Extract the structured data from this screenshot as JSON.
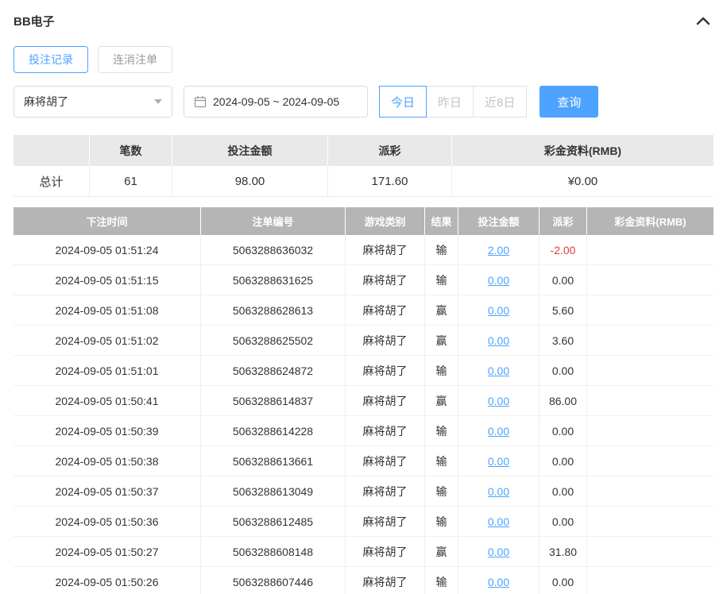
{
  "page": {
    "title": "BB电子"
  },
  "tabs": [
    {
      "label": "投注记录",
      "active": true
    },
    {
      "label": "连消注单",
      "active": false
    }
  ],
  "filters": {
    "game_select_value": "麻将胡了",
    "date_range_value": "2024-09-05 ~ 2024-09-05",
    "quick_buttons": [
      {
        "label": "今日",
        "active": true
      },
      {
        "label": "昨日",
        "active": false
      },
      {
        "label": "近8日",
        "active": false
      }
    ],
    "search_label": "查询"
  },
  "summary": {
    "headers": [
      "",
      "笔数",
      "投注金额",
      "派彩",
      "彩金资料(RMB)"
    ],
    "row": {
      "label": "总计",
      "count": "61",
      "bet_amount": "98.00",
      "payout": "171.60",
      "bonus": "¥0.00"
    }
  },
  "table": {
    "headers": [
      "下注时间",
      "注单编号",
      "游戏类别",
      "结果",
      "投注金额",
      "派彩",
      "彩金资料(RMB)"
    ],
    "rows": [
      {
        "time": "2024-09-05 01:51:24",
        "order": "5063288636032",
        "game": "麻将胡了",
        "result": "输",
        "bet": "2.00",
        "payout": "-2.00",
        "bonus": ""
      },
      {
        "time": "2024-09-05 01:51:15",
        "order": "5063288631625",
        "game": "麻将胡了",
        "result": "输",
        "bet": "0.00",
        "payout": "0.00",
        "bonus": ""
      },
      {
        "time": "2024-09-05 01:51:08",
        "order": "5063288628613",
        "game": "麻将胡了",
        "result": "赢",
        "bet": "0.00",
        "payout": "5.60",
        "bonus": ""
      },
      {
        "time": "2024-09-05 01:51:02",
        "order": "5063288625502",
        "game": "麻将胡了",
        "result": "赢",
        "bet": "0.00",
        "payout": "3.60",
        "bonus": ""
      },
      {
        "time": "2024-09-05 01:51:01",
        "order": "5063288624872",
        "game": "麻将胡了",
        "result": "输",
        "bet": "0.00",
        "payout": "0.00",
        "bonus": ""
      },
      {
        "time": "2024-09-05 01:50:41",
        "order": "5063288614837",
        "game": "麻将胡了",
        "result": "赢",
        "bet": "0.00",
        "payout": "86.00",
        "bonus": ""
      },
      {
        "time": "2024-09-05 01:50:39",
        "order": "5063288614228",
        "game": "麻将胡了",
        "result": "输",
        "bet": "0.00",
        "payout": "0.00",
        "bonus": ""
      },
      {
        "time": "2024-09-05 01:50:38",
        "order": "5063288613661",
        "game": "麻将胡了",
        "result": "输",
        "bet": "0.00",
        "payout": "0.00",
        "bonus": ""
      },
      {
        "time": "2024-09-05 01:50:37",
        "order": "5063288613049",
        "game": "麻将胡了",
        "result": "输",
        "bet": "0.00",
        "payout": "0.00",
        "bonus": ""
      },
      {
        "time": "2024-09-05 01:50:36",
        "order": "5063288612485",
        "game": "麻将胡了",
        "result": "输",
        "bet": "0.00",
        "payout": "0.00",
        "bonus": ""
      },
      {
        "time": "2024-09-05 01:50:27",
        "order": "5063288608148",
        "game": "麻将胡了",
        "result": "赢",
        "bet": "0.00",
        "payout": "31.80",
        "bonus": ""
      },
      {
        "time": "2024-09-05 01:50:26",
        "order": "5063288607446",
        "game": "麻将胡了",
        "result": "输",
        "bet": "0.00",
        "payout": "0.00",
        "bonus": ""
      }
    ]
  },
  "colors": {
    "accent": "#4da3ff",
    "negative": "#e23b3b",
    "table_header_bg": "#b5b5b5",
    "summary_header_bg": "#e9e9e9"
  }
}
